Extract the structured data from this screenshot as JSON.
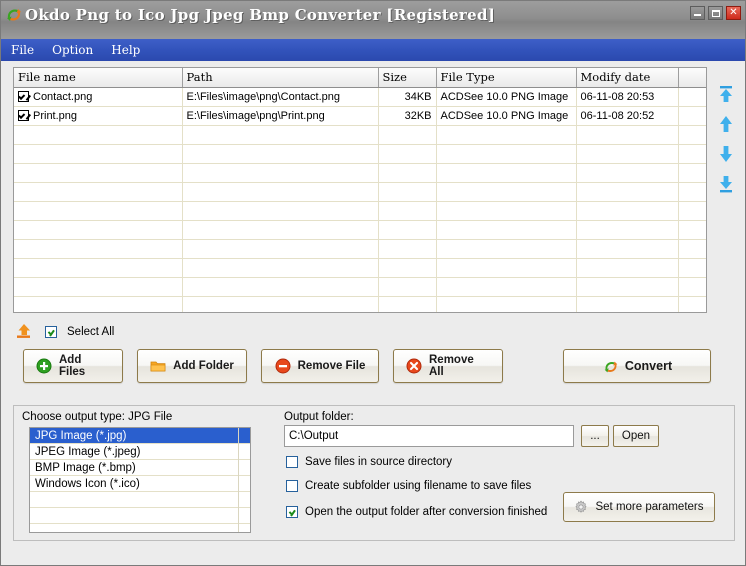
{
  "window": {
    "title": "Okdo Png to Ico Jpg Jpeg Bmp Converter [Registered]",
    "app_icon": "convert-arrows-icon",
    "controls": {
      "minimize": "minimize-button",
      "maximize": "maximize-button",
      "close": "close-button"
    }
  },
  "menubar": {
    "items": [
      "File",
      "Option",
      "Help"
    ]
  },
  "filelist": {
    "columns": [
      "File name",
      "Path",
      "Size",
      "File Type",
      "Modify date",
      ""
    ],
    "rows": [
      {
        "checked": true,
        "name": "Contact.png",
        "path": "E:\\Files\\image\\png\\Contact.png",
        "size": "34KB",
        "type": "ACDSee 10.0 PNG Image",
        "modified": "06-11-08 20:53"
      },
      {
        "checked": true,
        "name": "Print.png",
        "path": "E:\\Files\\image\\png\\Print.png",
        "size": "32KB",
        "type": "ACDSee 10.0 PNG Image",
        "modified": "06-11-08 20:52"
      }
    ],
    "empty_row_count": 11
  },
  "order_buttons": [
    {
      "name": "move-to-top-button",
      "icon": "arrow-up-to-bar-icon"
    },
    {
      "name": "move-up-button",
      "icon": "arrow-up-icon"
    },
    {
      "name": "move-down-button",
      "icon": "arrow-down-icon"
    },
    {
      "name": "move-to-bottom-button",
      "icon": "arrow-down-to-bar-icon"
    }
  ],
  "toolbar": {
    "up_icon": "move-up-tray-icon",
    "select_all_label": "Select All",
    "select_all_checked": true,
    "buttons": [
      {
        "label": "Add Files",
        "icon": "green-plus-icon"
      },
      {
        "label": "Add Folder",
        "icon": "orange-folder-icon"
      },
      {
        "label": "Remove File",
        "icon": "red-minus-icon"
      },
      {
        "label": "Remove All",
        "icon": "red-x-icon"
      }
    ],
    "convert": {
      "label": "Convert",
      "icon": "convert-arrows-icon"
    }
  },
  "output": {
    "group_label": "Choose output type:  JPG File",
    "types": [
      "JPG Image (*.jpg)",
      "JPEG Image (*.jpeg)",
      "BMP Image (*.bmp)",
      "Windows Icon (*.ico)"
    ],
    "selected_index": 0,
    "folder_label": "Output folder:",
    "folder_value": "C:\\Output",
    "folder_placeholder": "",
    "browse_label": "...",
    "open_label": "Open",
    "options": [
      {
        "label": "Save files in source directory",
        "checked": false
      },
      {
        "label": "Create subfolder using filename to save files",
        "checked": false
      },
      {
        "label": "Open the output folder after conversion finished",
        "checked": true
      }
    ],
    "params_button": {
      "label": "Set more parameters",
      "icon": "gear-icon"
    }
  },
  "colors": {
    "titlebar": "#8e8e8e",
    "menubar": "#3253bb",
    "accent_selection": "#2a5fce",
    "close_button": "#cf2a1b",
    "grid_line": "#e4e0c8",
    "button_border": "#8d7a4a"
  }
}
